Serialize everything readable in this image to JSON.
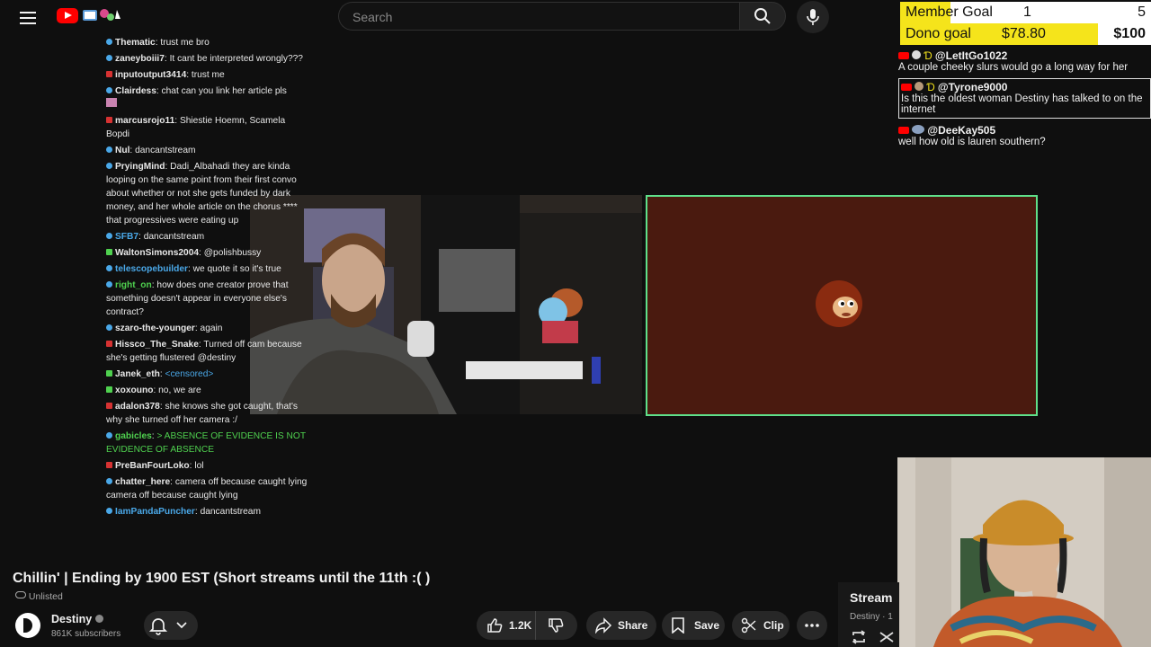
{
  "search": {
    "placeholder": "Search"
  },
  "chat": [
    {
      "user": "Thematic",
      "text": "trust me bro",
      "badge": "blue"
    },
    {
      "user": "zaneyboiii7",
      "text": "It cant be interpreted wrongly???",
      "badge": "blue"
    },
    {
      "user": "inputoutput3414",
      "text": "trust me",
      "badge": "red"
    },
    {
      "user": "Clairdess",
      "text": "chat can you link her article pls",
      "badge": "blue"
    },
    {
      "user": "marcusrojo11",
      "text": "Shiestie Hoemn, Scamela Bopdi",
      "badge": "red"
    },
    {
      "user": "Nul",
      "text": "dancantstream",
      "badge": "blue"
    },
    {
      "user": "PryingMind",
      "text": "Dadi_Albahadi they are kinda looping on the same point from their first convo about whether or not she gets funded by dark money, and her whole article on the chorus **** that progressives were eating up",
      "badge": "blue"
    },
    {
      "user": "SFB7",
      "text": "dancantstream",
      "badge": "blue"
    },
    {
      "user": "WaltonSimons2004",
      "text": "@polishbussy",
      "badge": "green"
    },
    {
      "user": "telescopebuilder",
      "text": "we quote it so it's true",
      "badge": "blue"
    },
    {
      "user": "right_on",
      "text": "how does one creator prove that something doesn't appear in everyone else's contract?",
      "badge": "blue"
    },
    {
      "user": "szaro-the-younger",
      "text": "again",
      "badge": "blue"
    },
    {
      "user": "Hissco_The_Snake",
      "text": "Turned off cam because she's getting flustered @destiny",
      "badge": "red"
    },
    {
      "user": "Janek_eth",
      "text": "<censored>",
      "badge": "green"
    },
    {
      "user": "xoxouno",
      "text": "no, we are",
      "badge": "green"
    },
    {
      "user": "adalon378",
      "text": "she knows she got caught, that's why she turned off her camera :/",
      "badge": "red"
    },
    {
      "user": "gabicles",
      "text": "> ABSENCE OF EVIDENCE IS NOT EVIDENCE OF ABSENCE",
      "badge": "blue"
    },
    {
      "user": "PreBanFourLoko",
      "text": "lol",
      "badge": "red"
    },
    {
      "user": "chatter_here",
      "text": "camera off because caught lying camera off because caught lying",
      "badge": "blue"
    },
    {
      "user": "IamPandaPuncher",
      "text": "dancantstream",
      "badge": "blue"
    }
  ],
  "goals": {
    "member": {
      "label": "Member Goal",
      "current": "1",
      "target": "5",
      "progress": 0.2
    },
    "dono": {
      "label": "Dono goal",
      "current": "$78.80",
      "target": "$100",
      "progress": 0.788
    }
  },
  "yt_chat": [
    {
      "name": "@LetItGo1022",
      "text": "A couple cheeky slurs would go a long way for her"
    },
    {
      "name": "@Tyrone9000",
      "text": "Is this the oldest woman Destiny has talked to on the internet"
    },
    {
      "name": "@DeeKay505",
      "text": "well how old is lauren southern?"
    }
  ],
  "video": {
    "title": "Chillin' | Ending by 1900 EST (Short streams until the 11th :( )",
    "visibility": "Unlisted",
    "channel": "Destiny",
    "subscribers": "861K subscribers",
    "likes": "1.2K",
    "share_label": "Share",
    "save_label": "Save",
    "clip_label": "Clip"
  },
  "stream_card": {
    "title": "Stream",
    "subtitle": "Destiny · 1"
  },
  "colors": {
    "accent_green": "#5fe08a",
    "goal_yellow": "#f5e41b",
    "brand_red": "#ff0000"
  }
}
